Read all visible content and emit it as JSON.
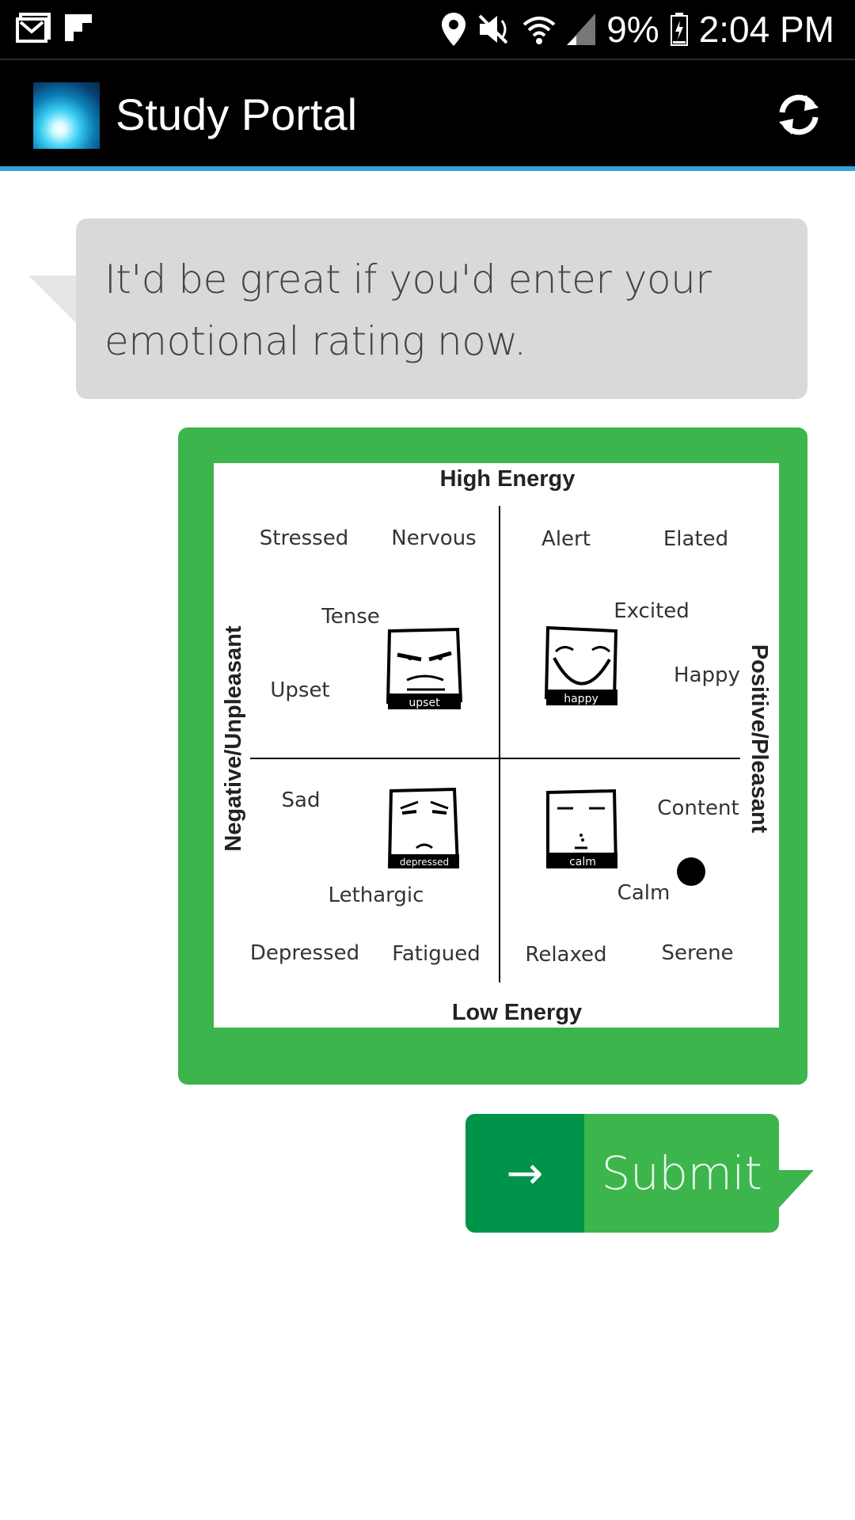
{
  "status_bar": {
    "battery": "9%",
    "time": "2:04 PM",
    "icons": [
      "gmail-icon",
      "flipboard-icon",
      "location-icon",
      "mute-icon",
      "wifi-icon",
      "signal-icon",
      "battery-icon"
    ]
  },
  "app_bar": {
    "title": "Study Portal",
    "accent_color": "#33a3dc",
    "action_icon": "refresh-icon"
  },
  "prompt": {
    "text": "It'd be great if you'd enter your emotional rating now."
  },
  "mood_grid": {
    "card_color": "#3cb54c",
    "top_label": "High Energy",
    "bottom_label": "Low Energy",
    "left_label": "Negative/Unpleasant",
    "right_label": "Positive/Pleasant",
    "words": {
      "stressed": "Stressed",
      "nervous": "Nervous",
      "alert": "Alert",
      "elated": "Elated",
      "tense": "Tense",
      "excited": "Excited",
      "upset": "Upset",
      "happy": "Happy",
      "sad": "Sad",
      "content": "Content",
      "lethargic": "Lethargic",
      "calm": "Calm",
      "depressed": "Depressed",
      "fatigued": "Fatigued",
      "relaxed": "Relaxed",
      "serene": "Serene"
    },
    "faces": {
      "upset": "upset",
      "happy": "happy",
      "depressed": "depressed",
      "calm": "calm"
    },
    "selected_quadrant": "positive-low-energy"
  },
  "submit": {
    "arrow": "→",
    "label": "Submit",
    "color": "#3cb54c",
    "arrow_bg": "#00934a"
  }
}
